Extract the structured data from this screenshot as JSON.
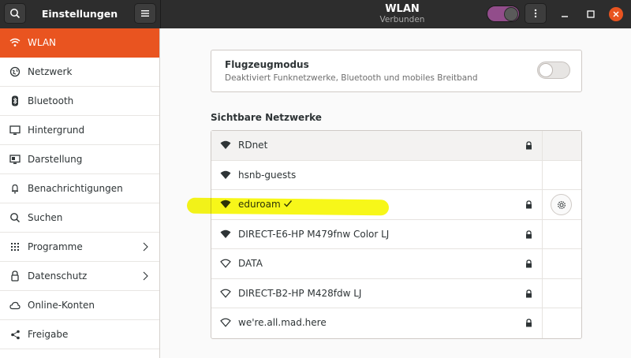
{
  "header": {
    "sidebar_title": "Einstellungen",
    "title": "WLAN",
    "subtitle": "Verbunden",
    "search_icon": "search-icon",
    "menu_icon": "hamburger-icon",
    "wifi_enabled": true,
    "accent_color": "#e95420",
    "toggle_color": "#924d8b"
  },
  "sidebar": {
    "items": [
      {
        "label": "WLAN",
        "icon": "wifi-icon",
        "active": true
      },
      {
        "label": "Netzwerk",
        "icon": "network-icon"
      },
      {
        "label": "Bluetooth",
        "icon": "bluetooth-icon"
      },
      {
        "label": "Hintergrund",
        "icon": "background-icon"
      },
      {
        "label": "Darstellung",
        "icon": "appearance-icon"
      },
      {
        "label": "Benachrichtigungen",
        "icon": "bell-icon"
      },
      {
        "label": "Suchen",
        "icon": "search-icon"
      },
      {
        "label": "Programme",
        "icon": "apps-icon",
        "has_submenu": true
      },
      {
        "label": "Datenschutz",
        "icon": "lock-icon",
        "has_submenu": true
      },
      {
        "label": "Online-Konten",
        "icon": "cloud-icon"
      },
      {
        "label": "Freigabe",
        "icon": "share-icon"
      }
    ]
  },
  "airplane": {
    "title": "Flugzeugmodus",
    "description": "Deaktiviert Funknetzwerke, Bluetooth und mobiles Breitband",
    "enabled": false
  },
  "networks": {
    "section_title": "Sichtbare Netzwerke",
    "list": [
      {
        "ssid": "RDnet",
        "secured": true,
        "connected": false
      },
      {
        "ssid": "hsnb-guests",
        "secured": false,
        "connected": false
      },
      {
        "ssid": "eduroam",
        "secured": true,
        "connected": true
      },
      {
        "ssid": "DIRECT-E6-HP M479fnw Color LJ",
        "secured": true,
        "connected": false
      },
      {
        "ssid": "DATA",
        "secured": true,
        "connected": false
      },
      {
        "ssid": "DIRECT-B2-HP M428fdw LJ",
        "secured": true,
        "connected": false
      },
      {
        "ssid": "we're.all.mad.here",
        "secured": true,
        "connected": false
      }
    ]
  }
}
